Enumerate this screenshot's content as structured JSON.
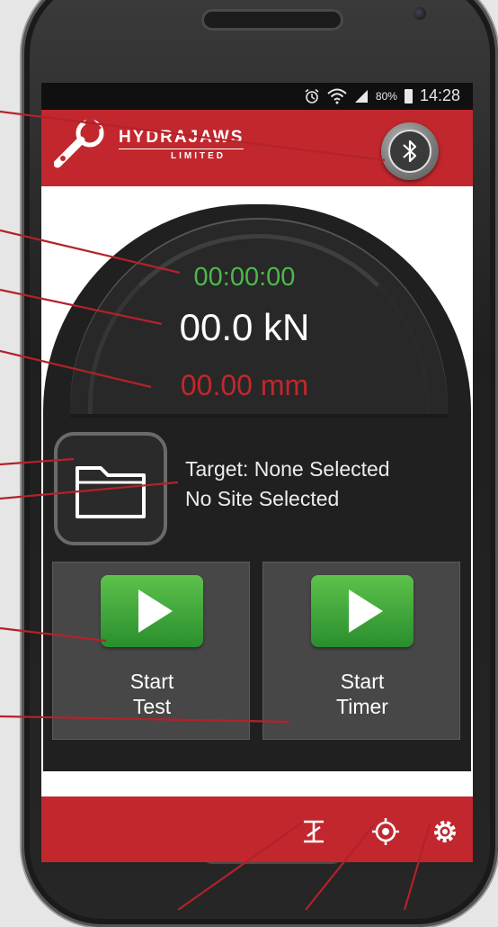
{
  "status_bar": {
    "alarm_icon": "alarm-icon",
    "wifi_icon": "wifi-icon",
    "signal_icon": "signal-icon",
    "battery_percent": "80%",
    "time": "14:28"
  },
  "header": {
    "logo_text": "HYDRAJAWS",
    "logo_sub": "LIMITED",
    "bluetooth_icon": "bluetooth-icon"
  },
  "readouts": {
    "timer": "00:00:00",
    "force": "00.0 kN",
    "displacement": "00.00 mm"
  },
  "selection": {
    "target": "Target: None Selected",
    "site": "No Site Selected"
  },
  "buttons": {
    "start_test_line1": "Start",
    "start_test_line2": "Test",
    "start_timer_line1": "Start",
    "start_timer_line2": "Timer"
  },
  "bottom_bar": {
    "icons": [
      "calibrate-icon",
      "target-icon",
      "settings-icon"
    ]
  },
  "colors": {
    "brand_red": "#c1272d",
    "timer_green": "#4cb84c",
    "displacement_red": "#c1272d",
    "panel_dark": "#202020",
    "tile_grey": "#474747",
    "play_green": "#3aa63a"
  }
}
